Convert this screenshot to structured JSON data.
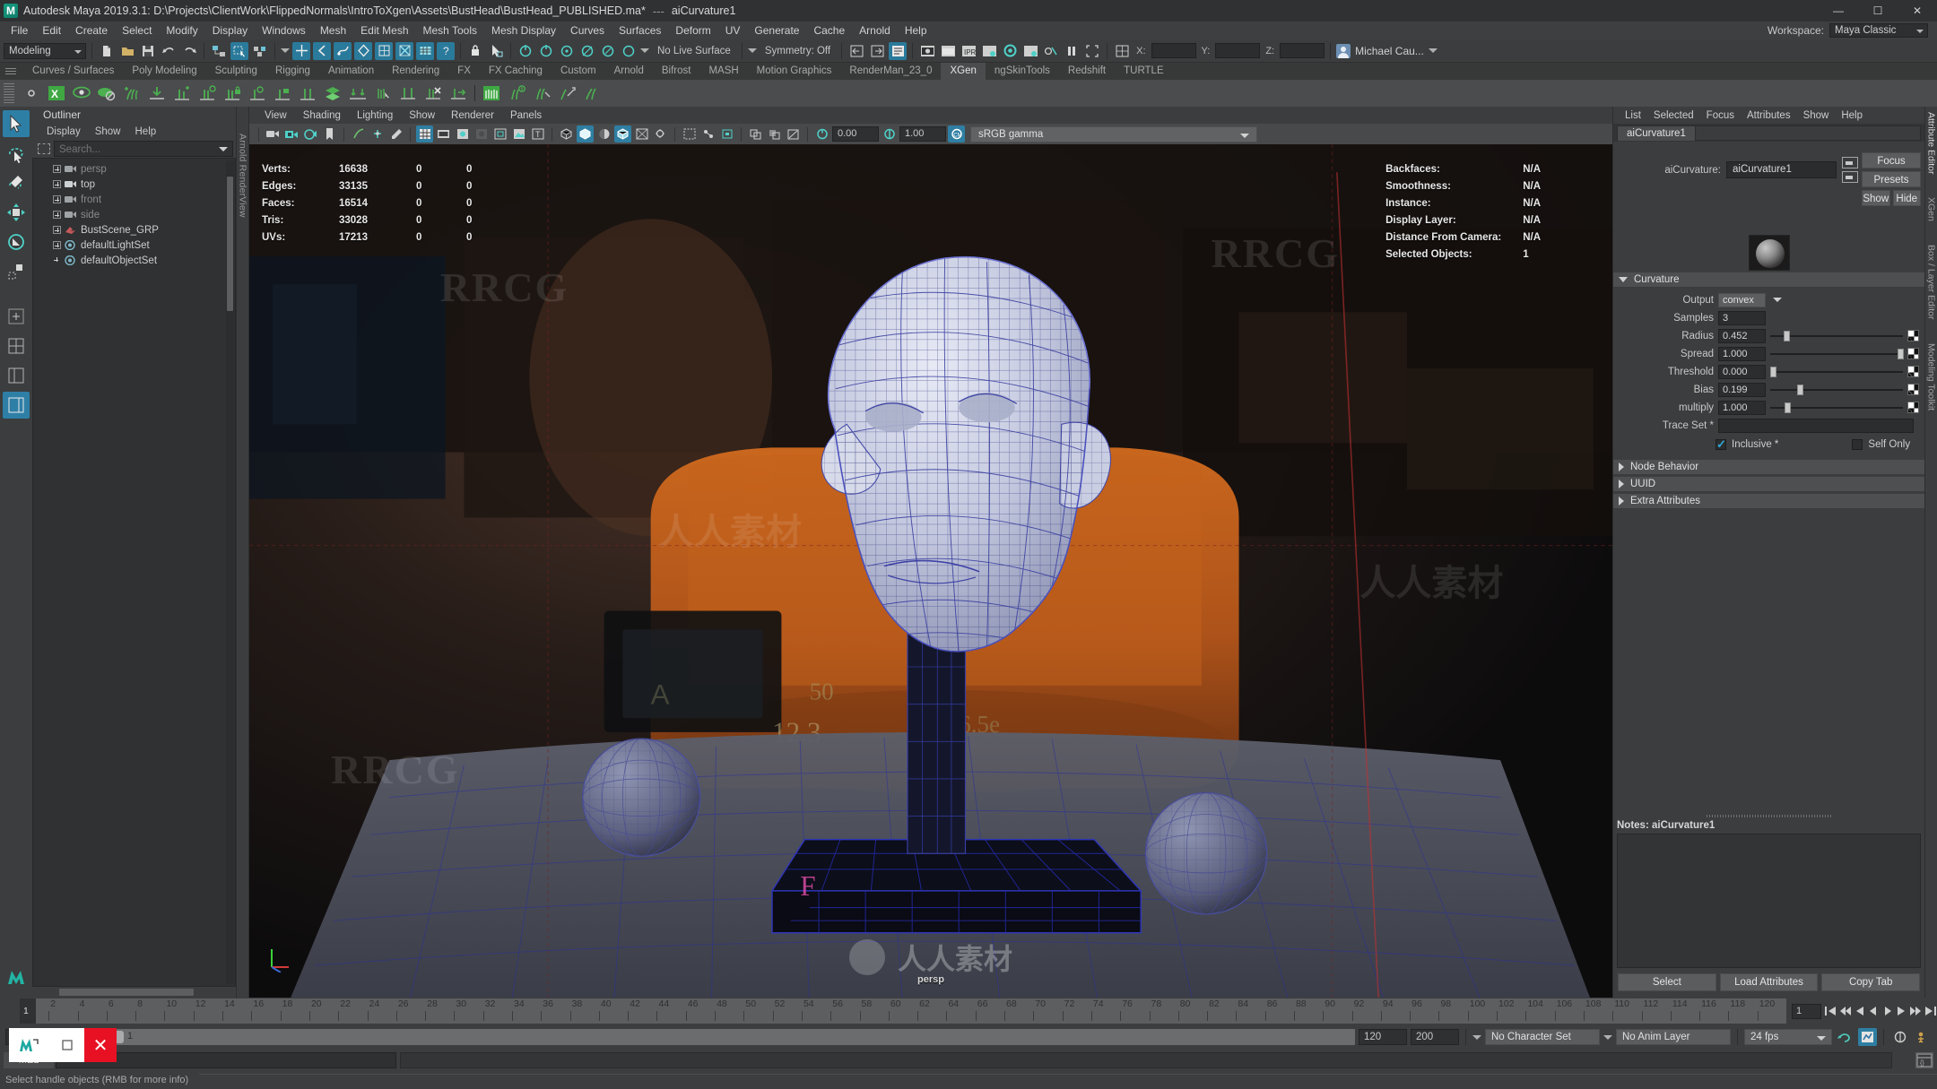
{
  "titlebar": {
    "app_title": "Autodesk Maya 2019.3.1: D:\\Projects\\ClientWork\\FlippedNormals\\IntroToXgen\\Assets\\BustHead\\BustHead_PUBLISHED.ma*",
    "separator": "---",
    "node_name": "aiCurvature1",
    "minimize": "—",
    "maximize": "☐",
    "close": "✕"
  },
  "menubar": {
    "items": [
      "File",
      "Edit",
      "Create",
      "Select",
      "Modify",
      "Display",
      "Windows",
      "Mesh",
      "Edit Mesh",
      "Mesh Tools",
      "Mesh Display",
      "Curves",
      "Surfaces",
      "Deform",
      "UV",
      "Generate",
      "Cache",
      "Arnold",
      "Help"
    ],
    "workspace_label": "Workspace:",
    "workspace_value": "Maya Classic"
  },
  "statusbar": {
    "mode": "Modeling",
    "live_surface": "No Live Surface",
    "symmetry": "Symmetry: Off",
    "axis_x": "X:",
    "axis_y": "Y:",
    "axis_z": "Z:",
    "user": "Michael Cau..."
  },
  "shelf_tabs": {
    "items": [
      "Curves / Surfaces",
      "Poly Modeling",
      "Sculpting",
      "Rigging",
      "Animation",
      "Rendering",
      "FX",
      "FX Caching",
      "Custom",
      "Arnold",
      "Bifrost",
      "MASH",
      "Motion Graphics",
      "RenderMan_23_0",
      "XGen",
      "ngSkinTools",
      "Redshift",
      "TURTLE"
    ],
    "active": "XGen"
  },
  "outliner": {
    "title": "Outliner",
    "menu": [
      "Display",
      "Show",
      "Help"
    ],
    "search_placeholder": "Search...",
    "items": [
      {
        "label": "persp",
        "icon": "camera-icon",
        "dim": true,
        "expandable": true
      },
      {
        "label": "top",
        "icon": "camera-icon",
        "dim": false,
        "expandable": true
      },
      {
        "label": "front",
        "icon": "camera-icon",
        "dim": true,
        "expandable": true
      },
      {
        "label": "side",
        "icon": "camera-icon",
        "dim": true,
        "expandable": true
      },
      {
        "label": "BustScene_GRP",
        "icon": "group-icon",
        "dim": false,
        "expandable": true
      },
      {
        "label": "defaultLightSet",
        "icon": "set-icon",
        "dim": false,
        "expandable": true
      },
      {
        "label": "defaultObjectSet",
        "icon": "set-icon",
        "dim": false,
        "expandable": false
      }
    ]
  },
  "vertical_tab_left": "Arnold RenderView",
  "viewport": {
    "menu": [
      "View",
      "Shading",
      "Lighting",
      "Show",
      "Renderer",
      "Panels"
    ],
    "exposure": "0.00",
    "gamma": "1.00",
    "color_space": "sRGB gamma",
    "camera_label": "persp",
    "hud_left": {
      "rows": [
        {
          "key": "Verts:",
          "v1": "16638",
          "v2": "0",
          "v3": "0"
        },
        {
          "key": "Edges:",
          "v1": "33135",
          "v2": "0",
          "v3": "0"
        },
        {
          "key": "Faces:",
          "v1": "16514",
          "v2": "0",
          "v3": "0"
        },
        {
          "key": "Tris:",
          "v1": "33028",
          "v2": "0",
          "v3": "0"
        },
        {
          "key": "UVs:",
          "v1": "17213",
          "v2": "0",
          "v3": "0"
        }
      ]
    },
    "hud_right": {
      "rows": [
        {
          "key": "Backfaces:",
          "value": "N/A"
        },
        {
          "key": "Smoothness:",
          "value": "N/A"
        },
        {
          "key": "Instance:",
          "value": "N/A"
        },
        {
          "key": "Display Layer:",
          "value": "N/A"
        },
        {
          "key": "Distance From Camera:",
          "value": "N/A"
        },
        {
          "key": "Selected Objects:",
          "value": "1"
        }
      ]
    }
  },
  "attribute_editor": {
    "panel_tab": "Attribute Editor",
    "menu": [
      "List",
      "Selected",
      "Focus",
      "Attributes",
      "Show",
      "Help"
    ],
    "node_tab": "aiCurvature1",
    "name_label": "aiCurvature:",
    "name_value": "aiCurvature1",
    "buttons": {
      "focus": "Focus",
      "presets": "Presets",
      "show": "Show",
      "hide": "Hide"
    },
    "sections": [
      {
        "title": "Curvature",
        "expanded": true
      },
      {
        "title": "Node Behavior",
        "expanded": false
      },
      {
        "title": "UUID",
        "expanded": false
      },
      {
        "title": "Extra Attributes",
        "expanded": false
      }
    ],
    "curvature": {
      "output_label": "Output",
      "output_value": "convex",
      "attrs": [
        {
          "label": "Samples",
          "value": "3",
          "slider": false,
          "pos": 0
        },
        {
          "label": "Radius",
          "value": "0.452",
          "slider": true,
          "pos": 10
        },
        {
          "label": "Spread",
          "value": "1.000",
          "slider": true,
          "pos": 97
        },
        {
          "label": "Threshold",
          "value": "0.000",
          "slider": true,
          "pos": 0
        },
        {
          "label": "Bias",
          "value": "0.199",
          "slider": true,
          "pos": 20
        },
        {
          "label": "multiply",
          "value": "1.000",
          "slider": true,
          "pos": 11
        }
      ],
      "trace_set_label": "Trace Set *",
      "trace_set_value": "",
      "inclusive_label": "Inclusive *",
      "inclusive_checked": true,
      "self_only_label": "Self Only",
      "self_only_checked": false
    },
    "notes_label": "Notes:",
    "notes_value": "aiCurvature1",
    "bottom_buttons": [
      "Select",
      "Load Attributes",
      "Copy Tab"
    ]
  },
  "right_tabs": [
    "Attribute Editor",
    "XGen",
    "Box / Layer Editor",
    "Modeling Toolkit"
  ],
  "timeline": {
    "current_frame": "1",
    "ticks": [
      "2",
      "4",
      "6",
      "8",
      "10",
      "12",
      "14",
      "16",
      "18",
      "20",
      "22",
      "24",
      "26",
      "28",
      "30",
      "32",
      "34",
      "36",
      "38",
      "40",
      "42",
      "44",
      "46",
      "48",
      "50",
      "52",
      "54",
      "56",
      "58",
      "60",
      "62",
      "64",
      "66",
      "68",
      "70",
      "72",
      "74",
      "76",
      "78",
      "80",
      "82",
      "84",
      "86",
      "88",
      "90",
      "92",
      "94",
      "96",
      "98",
      "100",
      "102",
      "104",
      "106",
      "108",
      "110",
      "112",
      "114",
      "116",
      "118",
      "120"
    ],
    "end_display": "1",
    "playback_start": "1",
    "playback_end": "120"
  },
  "range": {
    "range_start": "1",
    "range_end": "120",
    "anim_start": "120",
    "anim_end": "200",
    "character_set": "No Character Set",
    "anim_layer": "No Anim Layer",
    "fps": "24 fps"
  },
  "command_line": {
    "tab": "MEL",
    "input": "",
    "output": ""
  },
  "help_line": {
    "text": "Select handle objects (RMB for more info)"
  },
  "taskbar": {
    "app": "M",
    "restore": "☐",
    "close": "✕"
  },
  "watermarks": {
    "brand": "RRCG",
    "cn": "人人素材",
    "cn_short": "素材"
  },
  "colors": {
    "accent": "#2f7fa3",
    "panel_bg": "#3b3d3e",
    "field_bg": "#2b2d2e",
    "title_bg": "#2f3132",
    "close_red": "#e81123"
  }
}
